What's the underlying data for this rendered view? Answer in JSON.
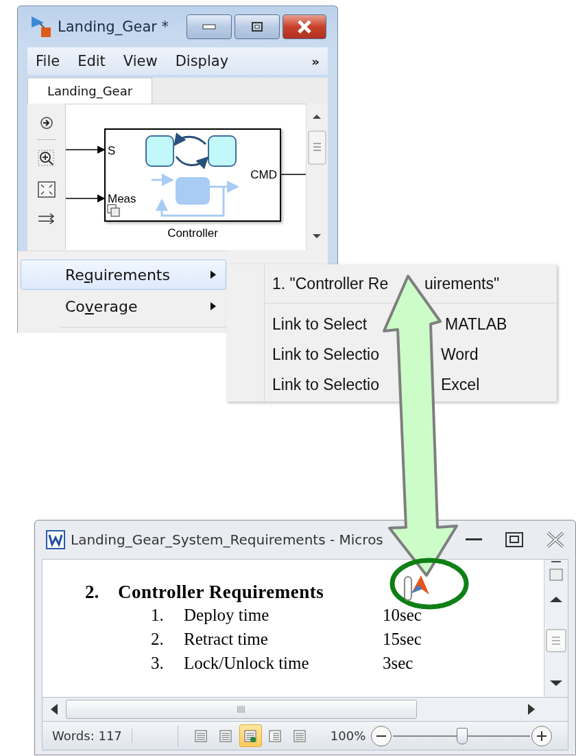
{
  "simulink_window": {
    "title": "Landing_Gear *",
    "menu": [
      "File",
      "Edit",
      "View",
      "Display"
    ],
    "menu_overflow": "»",
    "tabs": [
      {
        "label": "Landing_Gear",
        "selected": true
      }
    ],
    "block": {
      "name": "Controller",
      "inputs": [
        "S",
        "Meas"
      ],
      "output": "CMD"
    }
  },
  "context_menu": {
    "items": [
      {
        "label_parts": [
          "Re",
          "q",
          "uirements"
        ],
        "selected": true
      },
      {
        "label_parts": [
          "Co",
          "v",
          "erage"
        ],
        "selected": false
      }
    ]
  },
  "submenu": {
    "recent": [
      {
        "text_left": "1. \"Controller Re",
        "text_right": "uirements\""
      }
    ],
    "links": [
      {
        "text_left": "Link to Select",
        "text_right": "MATLAB"
      },
      {
        "text_left": "Link to Selectio",
        "text_right": "Word"
      },
      {
        "text_left": "Link to Selectio",
        "text_right": "Excel"
      }
    ]
  },
  "word_window": {
    "title": "Landing_Gear_System_Requirements - Micros",
    "heading": {
      "number": "2.",
      "text": "Controller Requirements"
    },
    "requirements": [
      {
        "number": "1.",
        "name": "Deploy time",
        "value": "10sec"
      },
      {
        "number": "2.",
        "name": "Retract time",
        "value": "15sec"
      },
      {
        "number": "3.",
        "name": "Lock/Unlock time",
        "value": "3sec"
      }
    ],
    "status_bar": {
      "words": "Words: 117",
      "views": [
        {
          "selected": false
        },
        {
          "selected": false
        },
        {
          "selected": true
        },
        {
          "selected": false
        },
        {
          "selected": false
        }
      ],
      "zoom": "100%",
      "zoom_slider": {
        "level": 0.5
      }
    }
  }
}
